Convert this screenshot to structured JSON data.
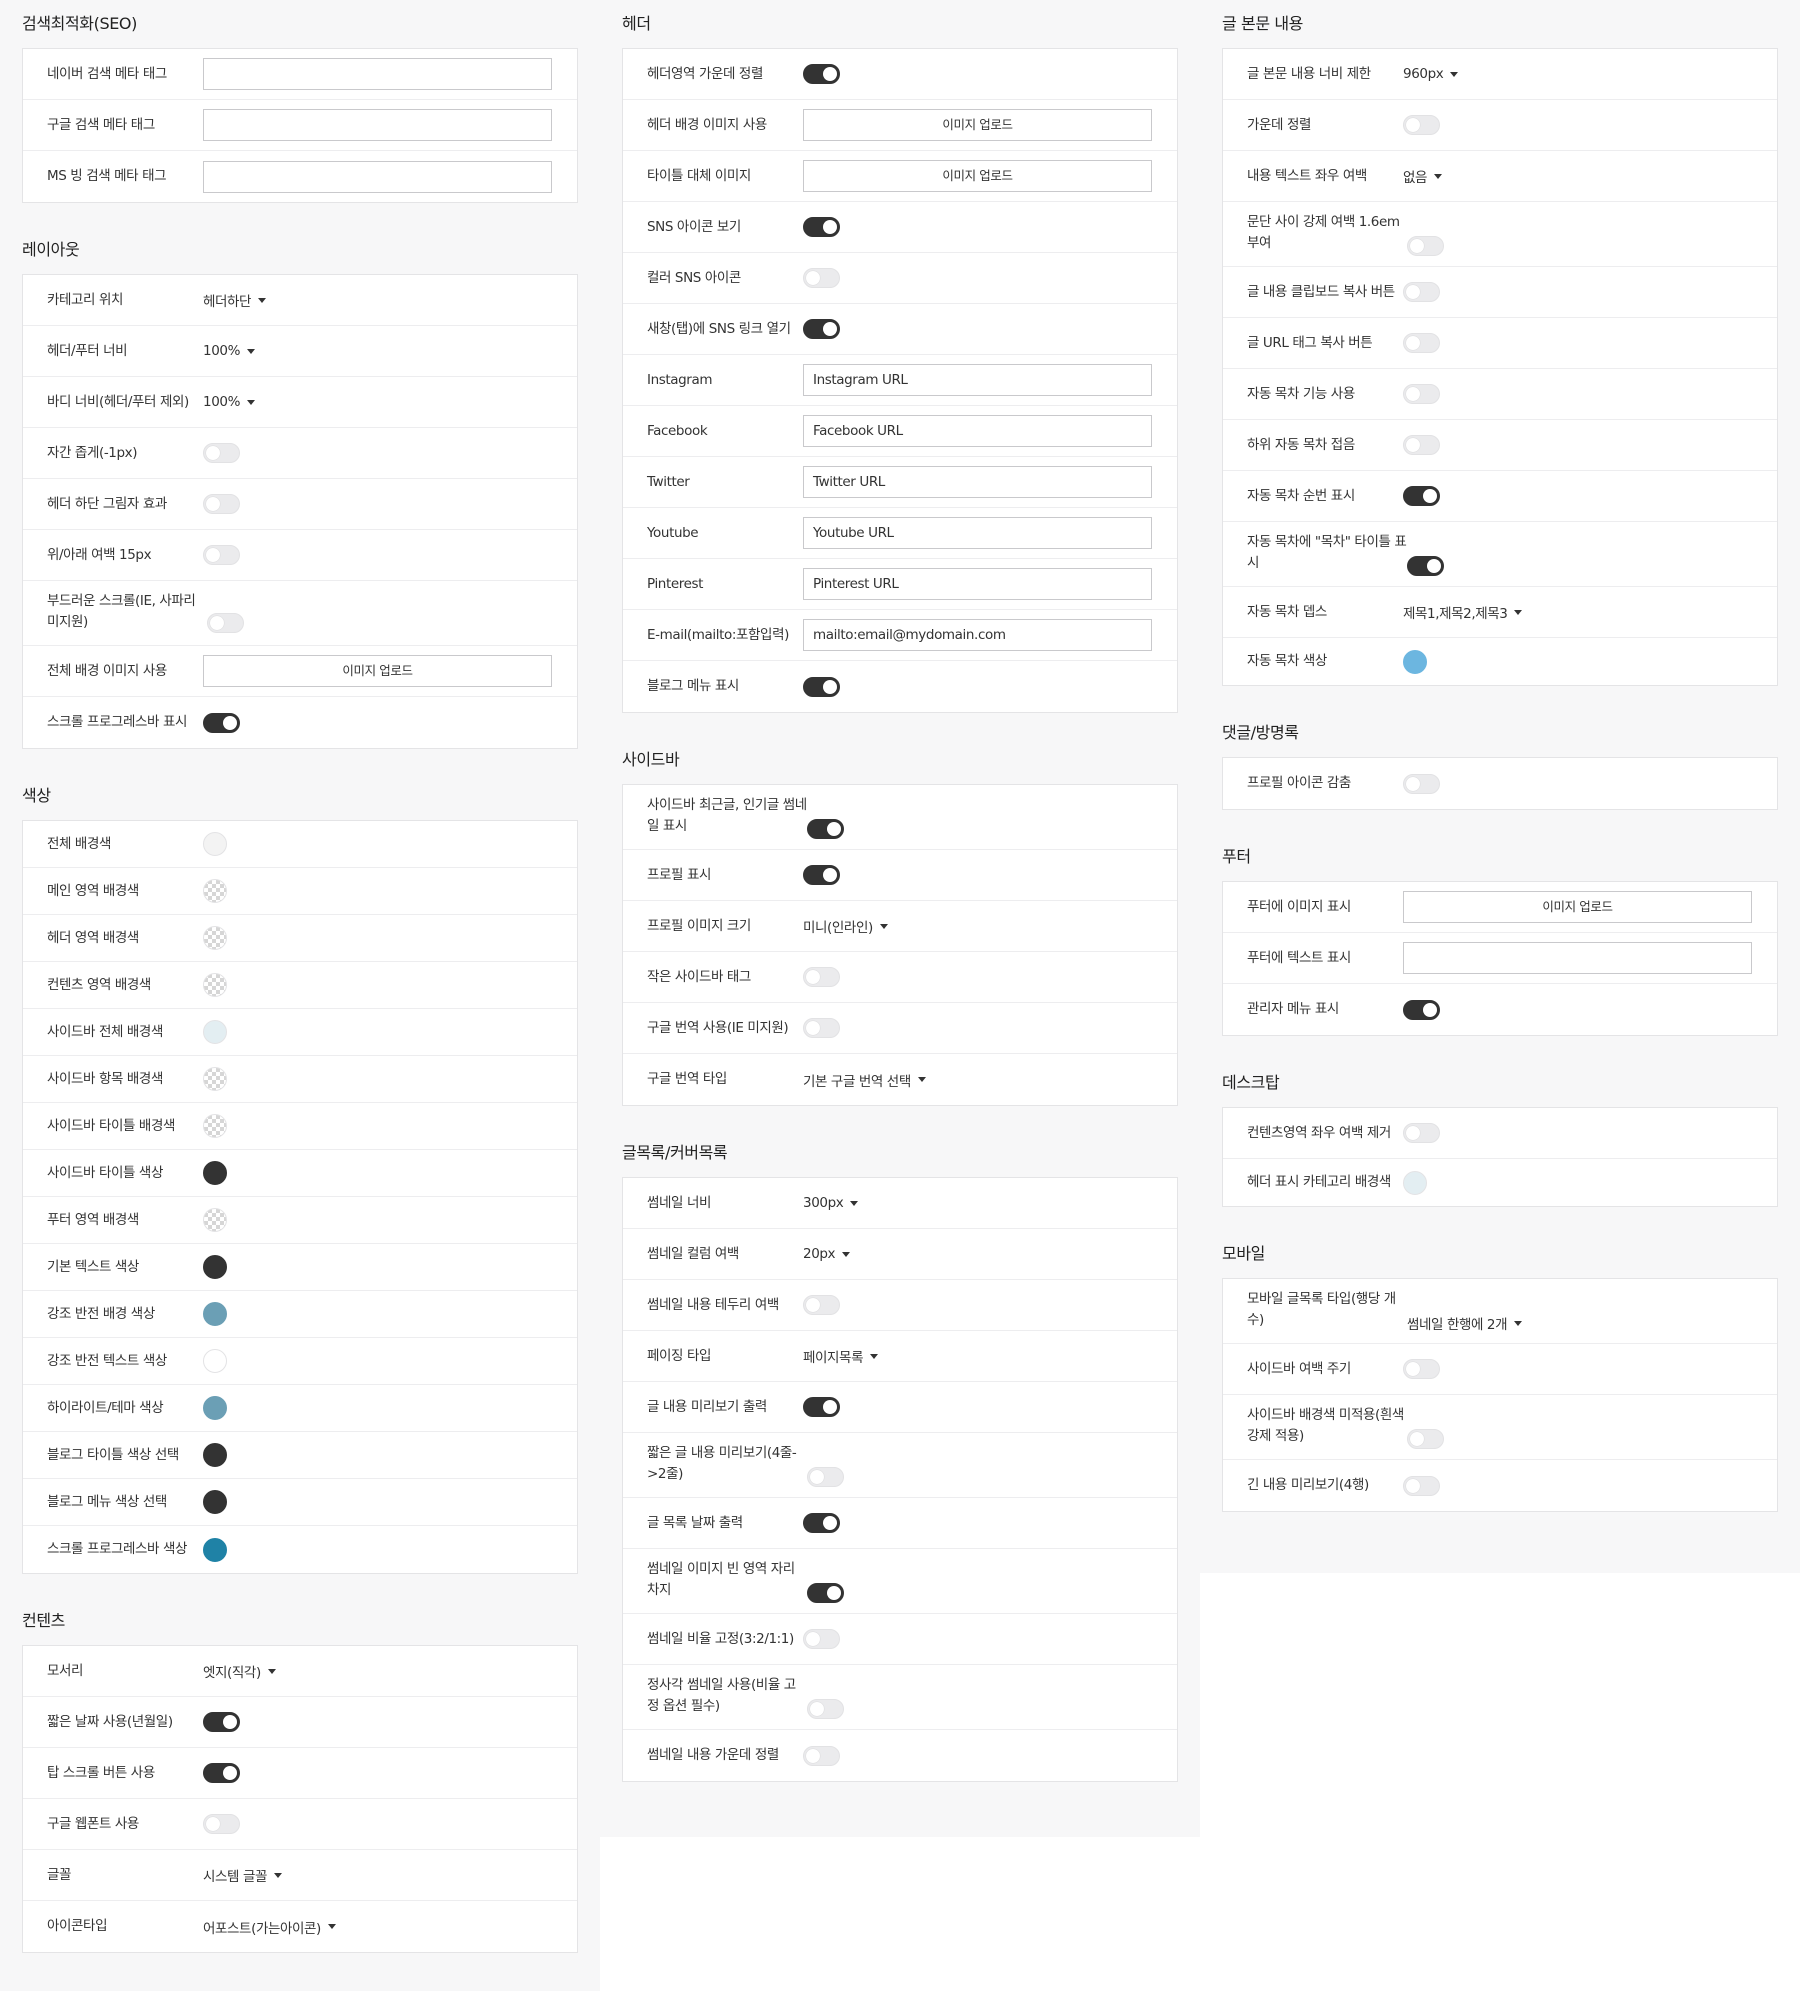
{
  "seo": {
    "title": "검색최적화(SEO)",
    "rows": [
      {
        "label": "네이버 검색 메타 태그",
        "value": ""
      },
      {
        "label": "구글 검색 메타 태그",
        "value": ""
      },
      {
        "label": "MS 빙 검색 메타 태그",
        "value": ""
      }
    ]
  },
  "layout": {
    "title": "레이아웃",
    "category_position": {
      "label": "카테고리 위치",
      "value": "헤더하단"
    },
    "header_footer_width": {
      "label": "헤더/푸터 너비",
      "value": "100%"
    },
    "body_width": {
      "label": "바디 너비(헤더/푸터 제외)",
      "value": "100%"
    },
    "letter_spacing": {
      "label": "자간 좁게(-1px)",
      "on": false
    },
    "header_shadow": {
      "label": "헤더 하단 그림자 효과",
      "on": false
    },
    "vertical_margin": {
      "label": "위/아래 여백 15px",
      "on": false
    },
    "smooth_scroll": {
      "label": "부드러운 스크롤(IE, 사파리 미지원)",
      "on": false
    },
    "bg_image": {
      "label": "전체 배경 이미지 사용",
      "button": "이미지 업로드"
    },
    "scroll_progress": {
      "label": "스크롤 프로그레스바 표시",
      "on": true
    }
  },
  "colors": {
    "title": "색상",
    "items": [
      {
        "label": "전체 배경색",
        "color": "#f3f3f3",
        "transparent": false
      },
      {
        "label": "메인 영역 배경색",
        "color": "",
        "transparent": true
      },
      {
        "label": "헤더 영역 배경색",
        "color": "",
        "transparent": true
      },
      {
        "label": "컨텐츠 영역 배경색",
        "color": "",
        "transparent": true
      },
      {
        "label": "사이드바 전체 배경색",
        "color": "#e3eef2",
        "transparent": false
      },
      {
        "label": "사이드바 항목 배경색",
        "color": "",
        "transparent": true
      },
      {
        "label": "사이드바 타이틀 배경색",
        "color": "",
        "transparent": true
      },
      {
        "label": "사이드바 타이틀 색상",
        "color": "#333333",
        "transparent": false
      },
      {
        "label": "푸터 영역 배경색",
        "color": "",
        "transparent": true
      },
      {
        "label": "기본 텍스트 색상",
        "color": "#333333",
        "transparent": false
      },
      {
        "label": "강조 반전 배경 색상",
        "color": "#6b9fb5",
        "transparent": false
      },
      {
        "label": "강조 반전 텍스트 색상",
        "color": "#ffffff",
        "transparent": false
      },
      {
        "label": "하이라이트/테마 색상",
        "color": "#6b9fb5",
        "transparent": false
      },
      {
        "label": "블로그 타이틀 색상 선택",
        "color": "#333333",
        "transparent": false
      },
      {
        "label": "블로그 메뉴 색상 선택",
        "color": "#333333",
        "transparent": false
      },
      {
        "label": "스크롤 프로그레스바 색상",
        "color": "#1f82a6",
        "transparent": false
      }
    ]
  },
  "contents": {
    "title": "컨텐츠",
    "corner": {
      "label": "모서리",
      "value": "엣지(직각)"
    },
    "short_date": {
      "label": "짧은 날짜 사용(년월일)",
      "on": true
    },
    "top_scroll": {
      "label": "탑 스크롤 버튼 사용",
      "on": true
    },
    "webfont": {
      "label": "구글 웹폰트 사용",
      "on": false
    },
    "font": {
      "label": "글꼴",
      "value": "시스템 글꼴"
    },
    "icon_type": {
      "label": "아이콘타입",
      "value": "어포스트(가는아이콘)"
    }
  },
  "header": {
    "title": "헤더",
    "center_align": {
      "label": "헤더영역 가운데 정렬",
      "on": true
    },
    "bg_image": {
      "label": "헤더 배경 이미지 사용",
      "button": "이미지 업로드"
    },
    "title_image": {
      "label": "타이틀 대체 이미지",
      "button": "이미지 업로드"
    },
    "sns_icon": {
      "label": "SNS 아이콘 보기",
      "on": true
    },
    "color_sns": {
      "label": "컬러 SNS 아이콘",
      "on": false
    },
    "new_tab": {
      "label": "새창(탭)에 SNS 링크 열기",
      "on": true
    },
    "links": [
      {
        "label": "Instagram",
        "value": "Instagram URL"
      },
      {
        "label": "Facebook",
        "value": "Facebook URL"
      },
      {
        "label": "Twitter",
        "value": "Twitter URL"
      },
      {
        "label": "Youtube",
        "value": "Youtube URL"
      },
      {
        "label": "Pinterest",
        "value": "Pinterest URL"
      },
      {
        "label": "E-mail(mailto:포함입력)",
        "value": "mailto:email@mydomain.com"
      }
    ],
    "blog_menu": {
      "label": "블로그 메뉴 표시",
      "on": true
    }
  },
  "sidebar": {
    "title": "사이드바",
    "thumb": {
      "label": "사이드바 최근글, 인기글 썸네일 표시",
      "on": true
    },
    "profile": {
      "label": "프로필 표시",
      "on": true
    },
    "profile_size": {
      "label": "프로필 이미지 크기",
      "value": "미니(인라인)"
    },
    "small_tag": {
      "label": "작은 사이드바 태그",
      "on": false
    },
    "google_translate": {
      "label": "구글 번역 사용(IE 미지원)",
      "on": false
    },
    "translate_type": {
      "label": "구글 번역 타입",
      "value": "기본 구글 번역 선택"
    }
  },
  "list": {
    "title": "글목록/커버목록",
    "thumb_width": {
      "label": "썸네일 너비",
      "value": "300px"
    },
    "thumb_column": {
      "label": "썸네일 컬럼 여백",
      "value": "20px"
    },
    "thumb_border": {
      "label": "썸네일 내용 테두리 여백",
      "on": false
    },
    "paging": {
      "label": "페이징 타입",
      "value": "페이지목록"
    },
    "preview": {
      "label": "글 내용 미리보기 출력",
      "on": true
    },
    "short_preview": {
      "label": "짧은 글 내용 미리보기(4줄->2줄)",
      "on": false
    },
    "date": {
      "label": "글 목록 날짜 출력",
      "on": true
    },
    "empty_space": {
      "label": "썸네일 이미지 빈 영역 자리 차지",
      "on": true
    },
    "ratio": {
      "label": "썸네일 비율 고정(3:2/1:1)",
      "on": false
    },
    "square": {
      "label": "정사각 썸네일 사용(비율 고정 옵션 필수)",
      "on": false
    },
    "center": {
      "label": "썸네일 내용 가운데 정렬",
      "on": false
    }
  },
  "body": {
    "title": "글 본문 내용",
    "width": {
      "label": "글 본문 내용 너비 제한",
      "value": "960px"
    },
    "center": {
      "label": "가운데 정렬",
      "on": false
    },
    "padding": {
      "label": "내용 텍스트 좌우 여백",
      "value": "없음"
    },
    "para": {
      "label": "문단 사이 강제 여백 1.6em 부여",
      "on": false
    },
    "clipboard": {
      "label": "글 내용 클립보드 복사 버튼",
      "on": false
    },
    "url_tag": {
      "label": "글 URL 태그 복사 버튼",
      "on": false
    },
    "toc": {
      "label": "자동 목차 기능 사용",
      "on": false
    },
    "toc_sub": {
      "label": "하위 자동 목차 접음",
      "on": false
    },
    "toc_num": {
      "label": "자동 목차 순번 표시",
      "on": true
    },
    "toc_title": {
      "label": "자동 목차에 \"목차\" 타이틀 표시",
      "on": true
    },
    "toc_depth": {
      "label": "자동 목차 뎁스",
      "value": "제목1,제목2,제목3"
    },
    "toc_color": {
      "label": "자동 목차 색상",
      "color": "#6cb6e0"
    }
  },
  "comment": {
    "title": "댓글/방명록",
    "hide_icon": {
      "label": "프로필 아이콘 감춤",
      "on": false
    }
  },
  "footer": {
    "title": "푸터",
    "image": {
      "label": "푸터에 이미지 표시",
      "button": "이미지 업로드"
    },
    "text": {
      "label": "푸터에 텍스트 표시",
      "value": ""
    },
    "admin": {
      "label": "관리자 메뉴 표시",
      "on": true
    }
  },
  "desktop": {
    "title": "데스크탑",
    "remove_margin": {
      "label": "컨텐츠영역 좌우 여백 제거",
      "on": false
    },
    "cat_bg": {
      "label": "헤더 표시 카테고리 배경색",
      "color": "#e3eef2"
    }
  },
  "mobile": {
    "title": "모바일",
    "list_type": {
      "label": "모바일 글목록 타입(행당 개수)",
      "value": "썸네일 한행에 2개"
    },
    "sidebar_margin": {
      "label": "사이드바 여백 주기",
      "on": false
    },
    "sidebar_bg": {
      "label": "사이드바 배경색 미적용(흰색 강제 적용)",
      "on": false
    },
    "long_preview": {
      "label": "긴 내용 미리보기(4행)",
      "on": false
    }
  }
}
